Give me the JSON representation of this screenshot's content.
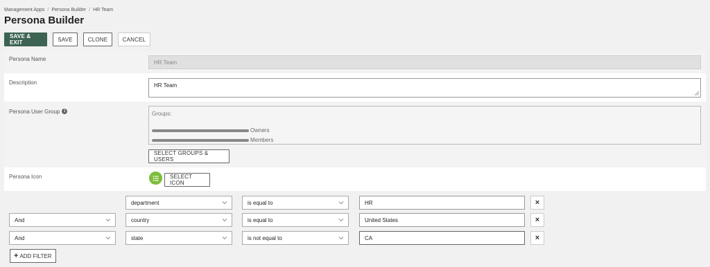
{
  "breadcrumb": [
    "Management Apps",
    "Persona Builder",
    "HR Team"
  ],
  "page_title": "Persona Builder",
  "toolbar": {
    "save_exit": "SAVE & EXIT",
    "save": "SAVE",
    "clone": "CLONE",
    "cancel": "CANCEL"
  },
  "form": {
    "persona_name_label": "Persona Name",
    "persona_name_value": "HR Team",
    "description_label": "Description",
    "description_value": "HR Team",
    "user_group_label": "Persona User Group",
    "groups_title": "Groups:",
    "groups": [
      {
        "suffix": "Owners"
      },
      {
        "suffix": "Members"
      }
    ],
    "select_groups_button": "SELECT GROUPS & USERS",
    "icon_label": "Persona Icon",
    "select_icon_button": "SELECT ICON"
  },
  "filters": [
    {
      "conjunction": "",
      "field": "department",
      "operator": "is equal to",
      "value": "HR"
    },
    {
      "conjunction": "And",
      "field": "country",
      "operator": "is equal to",
      "value": "United States"
    },
    {
      "conjunction": "And",
      "field": "state",
      "operator": "is not equal to",
      "value": "CA"
    }
  ],
  "add_filter_label": "ADD FILTER",
  "colors": {
    "primary": "#3d6352",
    "icon_green": "#7cbd3b"
  }
}
